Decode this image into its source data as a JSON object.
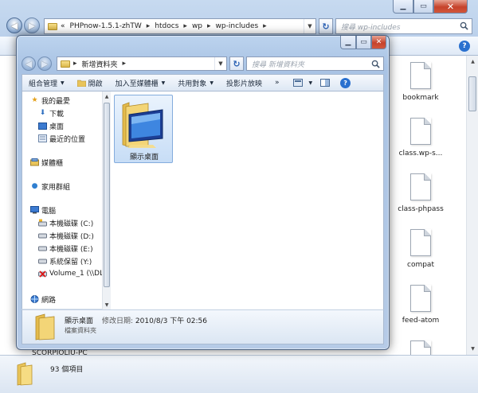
{
  "background_window": {
    "address_crumbs": [
      "«",
      "PHPnow-1.5.1-zhTW",
      "htdocs",
      "wp",
      "wp-includes"
    ],
    "search_placeholder": "搜尋 wp-includes",
    "files": [
      {
        "name": "bookmark"
      },
      {
        "name": "class.wp-s..."
      },
      {
        "name": "class-phpass"
      },
      {
        "name": "compat"
      },
      {
        "name": "feed-atom"
      },
      {
        "name": ""
      }
    ],
    "status": {
      "computer_name": "SCORPIOLIU-PC",
      "item_count": "93 個項目"
    }
  },
  "foreground_window": {
    "address_crumb": "新增資料夾",
    "search_placeholder": "搜尋 新增資料夾",
    "toolbar": {
      "organize": "組合管理",
      "open": "開啟",
      "include_in_library": "加入至媒體櫃",
      "share_with": "共用對象",
      "slide_show": "投影片放映",
      "more": "»"
    },
    "nav": {
      "favorites": "我的最愛",
      "downloads": "下載",
      "desktop": "桌面",
      "recent_places": "最近的位置",
      "libraries": "媒體櫃",
      "homegroup": "家用群組",
      "computer": "電腦",
      "drive_c": "本機磁碟 (C:)",
      "drive_d": "本機磁碟 (D:)",
      "drive_e": "本機磁碟 (E:)",
      "drive_y": "系統保留 (Y:)",
      "volume1": "Volume_1 (\\\\DL",
      "network": "網路"
    },
    "content": {
      "selected_item": "顯示桌面"
    },
    "details": {
      "name": "顯示桌面",
      "type": "檔案資料夾",
      "modified_label": "修改日期:",
      "modified_value": "2010/8/3 下午 02:56"
    }
  }
}
